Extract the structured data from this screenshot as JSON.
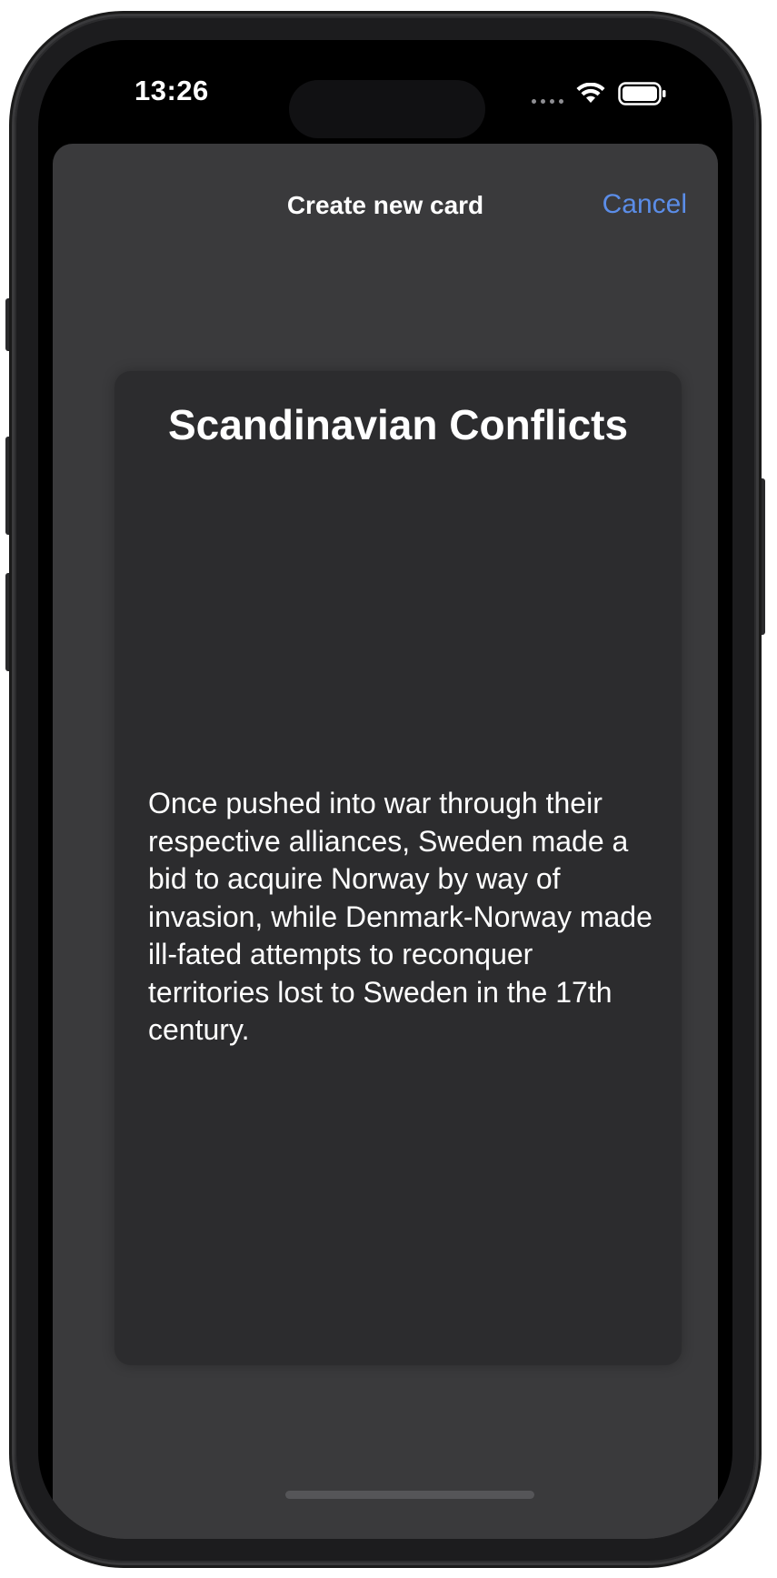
{
  "status_bar": {
    "time": "13:26",
    "signal_icon": "cellular-dots-icon",
    "wifi_icon": "wifi-icon",
    "battery_icon": "battery-icon"
  },
  "sheet": {
    "title": "Create new card",
    "cancel_label": "Cancel",
    "accent_color": "#5b8de8"
  },
  "card": {
    "title": "Scandinavian Conflicts",
    "body": "Once pushed into war through their respective alliances, Sweden made a bid to acquire Norway by way of invasion, while Denmark-Norway made ill-fated attempts to reconquer territories lost to Sweden in the 17th century."
  }
}
